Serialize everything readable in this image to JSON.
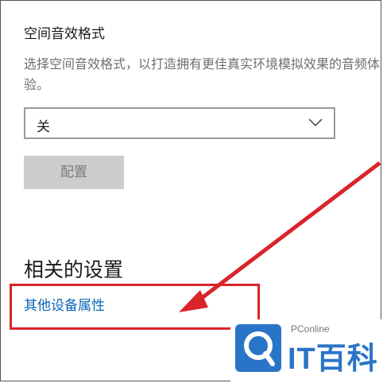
{
  "spatial": {
    "title": "空间音效格式",
    "description": "选择空间音效格式，以打造拥有更佳真实环境模拟效果的音频体验。",
    "select_value": "关",
    "configure_label": "配置"
  },
  "related": {
    "title": "相关的设置",
    "link_label": "其他设备属性"
  },
  "watermark": {
    "subtitle": "PConline",
    "brand": "IT百科"
  },
  "colors": {
    "link": "#0a66b8",
    "annotation_red": "#d9242a",
    "brand_blue": "#2a74c8"
  }
}
